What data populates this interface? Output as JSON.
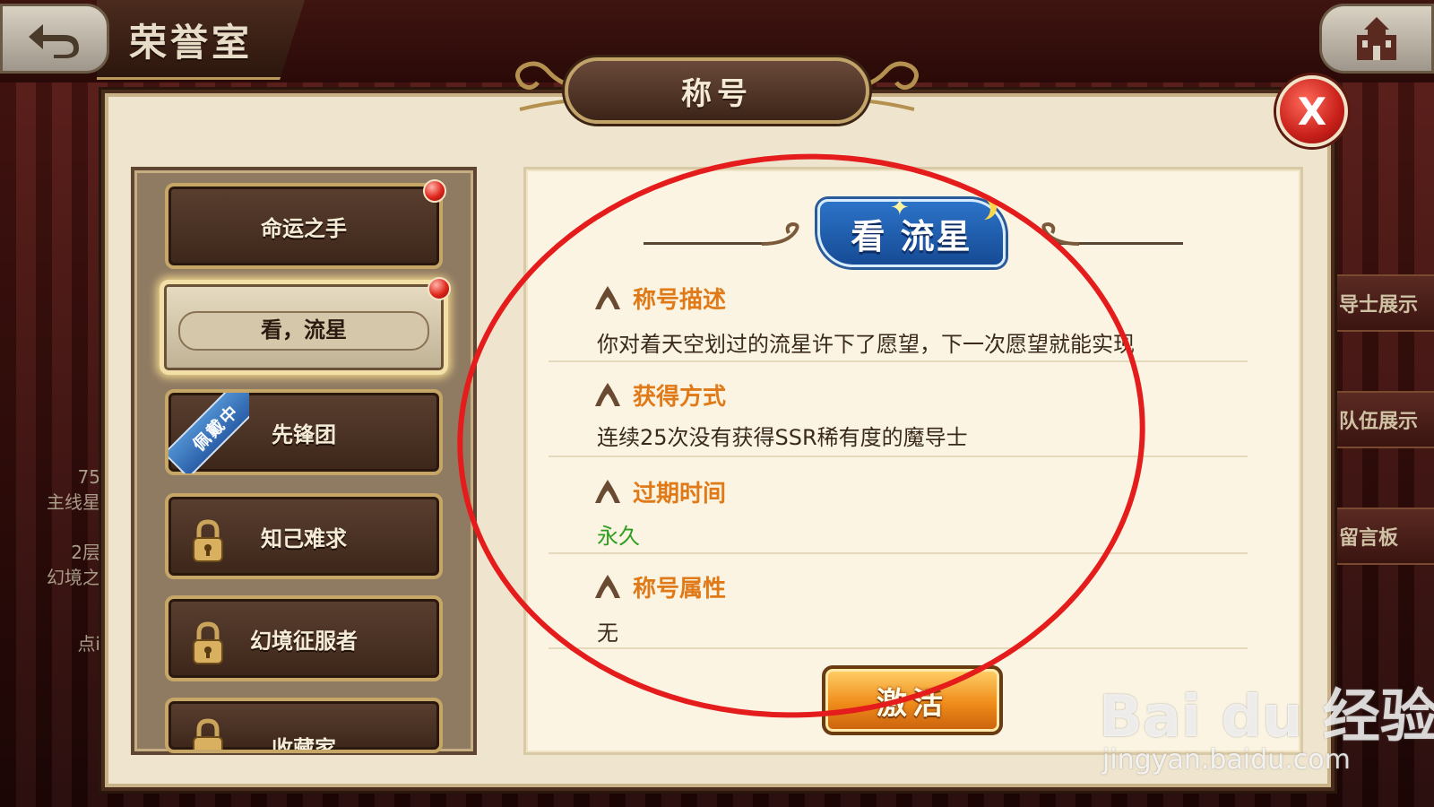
{
  "topbar": {
    "title": "荣誉室"
  },
  "side_tabs": [
    {
      "label": "导士展示"
    },
    {
      "label": "队伍展示"
    },
    {
      "label": "留言板"
    }
  ],
  "left_stub": {
    "line1": "75",
    "line2": "主线星",
    "line3": "2层",
    "line4": "幻境之",
    "line5": "点i"
  },
  "dialog": {
    "title": "称号",
    "close_label": "X"
  },
  "title_list": [
    {
      "label": "命运之手",
      "has_red_dot": true,
      "locked": false
    },
    {
      "label": "看，流星",
      "has_red_dot": true,
      "locked": false,
      "selected": true
    },
    {
      "label": "先锋团",
      "has_red_dot": false,
      "locked": false,
      "wearing_tag": "佩戴中"
    },
    {
      "label": "知己难求",
      "has_red_dot": false,
      "locked": true
    },
    {
      "label": "幻境征服者",
      "has_red_dot": false,
      "locked": true
    },
    {
      "label": "收藏家",
      "has_red_dot": false,
      "locked": true
    }
  ],
  "detail": {
    "badge_text": "看 流星",
    "sections": [
      {
        "title": "称号描述",
        "value": "你对着天空划过的流星许下了愿望，下一次愿望就能实现"
      },
      {
        "title": "获得方式",
        "value": "连续25次没有获得SSR稀有度的魔导士"
      },
      {
        "title": "过期时间",
        "value": "永久"
      },
      {
        "title": "称号属性",
        "value": "无"
      }
    ],
    "activate_label": "激活"
  },
  "watermark": {
    "main": "Bai du 经验",
    "sub": "jingyan.baidu.com"
  },
  "colors": {
    "accent_orange": "#e07a18",
    "permanent_green": "#2f9e1e",
    "close_red": "#c8201a",
    "annotation_red": "#e51c1c"
  }
}
